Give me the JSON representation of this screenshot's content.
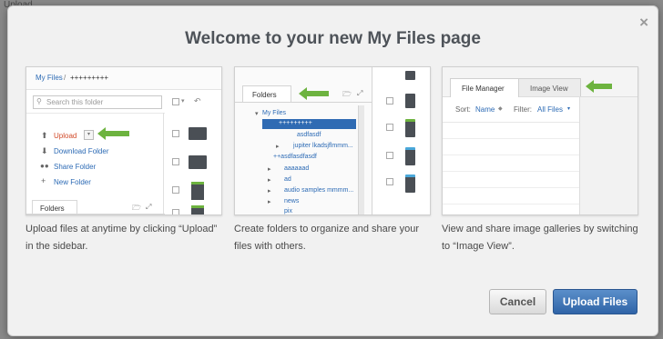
{
  "background": {
    "peek_text": "Upload"
  },
  "dialog": {
    "title": "Welcome to your new My Files page",
    "close_glyph": "×",
    "cards": [
      {
        "caption": "Upload files at anytime by clicking “Upload” in the sidebar.",
        "preview": {
          "breadcrumb_root": "My Files",
          "breadcrumb_sep": "/",
          "breadcrumb_current": "+++++++++",
          "search_placeholder": "Search this folder",
          "menu": [
            "Upload",
            "Download Folder",
            "Share Folder",
            "New Folder"
          ],
          "tab_label": "Folders"
        }
      },
      {
        "caption": "Create folders to organize and share your files with others.",
        "preview": {
          "tab_label": "Folders",
          "tree": [
            "My Files",
            "+++++++++",
            "asdfasdf",
            "jupiter lkadsjflmmm...",
            "++asdfasdfasdf",
            "aaaaaad",
            "ad",
            "audio samples mmmm...",
            "news",
            "pix"
          ]
        }
      },
      {
        "caption": "View and share image galleries by switching to “Image View”.",
        "preview": {
          "tabs": [
            "File Manager",
            "Image View"
          ],
          "sort_label": "Sort:",
          "sort_value": "Name",
          "filter_label": "Filter:",
          "filter_value": "All Files"
        }
      }
    ],
    "buttons": {
      "cancel": "Cancel",
      "upload": "Upload Files"
    }
  },
  "colors": {
    "arrow": "#6db33f",
    "link": "#2d6bb5",
    "primary": "#3a70b5",
    "upload": "#d24b2a"
  }
}
